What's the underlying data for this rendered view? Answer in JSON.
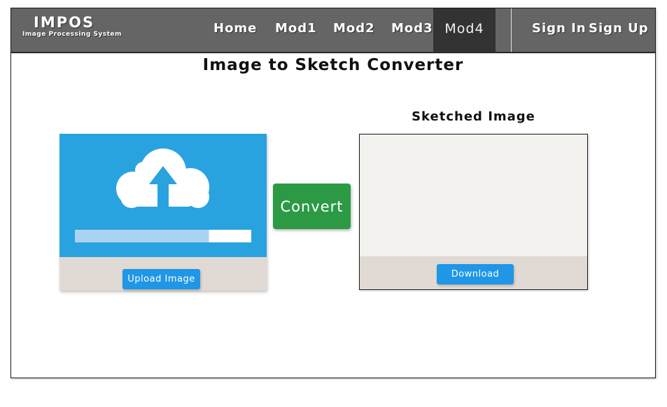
{
  "brand": {
    "title": "IMPOS",
    "subtitle": "Image Processing System"
  },
  "nav": {
    "items": [
      {
        "label": "Home",
        "active": false
      },
      {
        "label": "Mod1",
        "active": false
      },
      {
        "label": "Mod2",
        "active": false
      },
      {
        "label": "Mod3",
        "active": false
      },
      {
        "label": "Mod4",
        "active": true
      }
    ],
    "auth": {
      "sign_in": "Sign In",
      "sign_up": "Sign Up"
    }
  },
  "page": {
    "title": "Image to Sketch Converter"
  },
  "upload": {
    "icon": "cloud-upload-icon",
    "progress_fraction": 0.76,
    "button_label": "Upload Image"
  },
  "convert": {
    "button_label": "Convert"
  },
  "sketch": {
    "heading": "Sketched Image",
    "download_label": "Download"
  },
  "colors": {
    "navbar": "#656565",
    "nav_active": "#333333",
    "upload_bg": "#29a3df",
    "button_blue": "#1f96e6",
    "convert_green": "#2c9a44",
    "card_footer": "#e1d9d3",
    "sketch_bg": "#f4f2ef"
  }
}
